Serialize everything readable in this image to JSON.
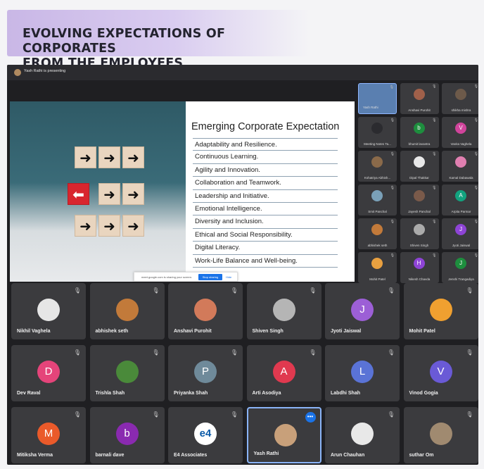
{
  "banner": {
    "title": "EVOLVING EXPECTATIONS OF CORPORATES\nFROM THE EMPLOYEES"
  },
  "meeting": {
    "presenting_text": "Yash Rathi is presenting",
    "slide": {
      "heading": "Emerging Corporate Expectation",
      "items": [
        "Adaptability and Resilience.",
        "Continuous Learning.",
        "Agility and Innovation.",
        "Collaboration and Teamwork.",
        "Leadership and Initiative.",
        "Emotional Intelligence.",
        "Diversity and Inclusion.",
        "Ethical and Social Responsibility.",
        "Digital Literacy.",
        "Work-Life Balance and Well-being."
      ]
    },
    "share_bar": {
      "text": "meet.google.com is sharing your screen.",
      "stop_label": "Stop sharing",
      "hide_label": "Hide"
    },
    "side_tiles": [
      {
        "name": "Yash Rathi",
        "initial": "",
        "color": "#5a7fb0",
        "self": true
      },
      {
        "name": "Anshavi Purohit",
        "initial": "",
        "color": "#a0604a"
      },
      {
        "name": "shikha mishra",
        "initial": "",
        "color": "#6d5a4a"
      },
      {
        "name": "Meeting Notes Ta...",
        "initial": "",
        "color": "#2b2b2f"
      },
      {
        "name": "bhumit lavantra",
        "initial": "b",
        "color": "#1e8e3e"
      },
      {
        "name": "Vanita Vaghela",
        "initial": "V",
        "color": "#d0449b"
      },
      {
        "name": "Kshatriya Abhish...",
        "initial": "",
        "color": "#8a6a4a"
      },
      {
        "name": "Dipal Thakkar",
        "initial": "",
        "color": "#e8e8e8"
      },
      {
        "name": "Kamal Dabawala",
        "initial": "",
        "color": "#e07fb0"
      },
      {
        "name": "Smit Panchal",
        "initial": "",
        "color": "#7aa0b8"
      },
      {
        "name": "Jayesh Panchal",
        "initial": "",
        "color": "#7a5a4a"
      },
      {
        "name": "Arpita Parmar",
        "initial": "A",
        "color": "#12a37f"
      },
      {
        "name": "abhishek seth",
        "initial": "",
        "color": "#c27a3a"
      },
      {
        "name": "Shiven Singh",
        "initial": "",
        "color": "#aaaaaa"
      },
      {
        "name": "Jyoti Jaiswal",
        "initial": "J",
        "color": "#8e44d6"
      },
      {
        "name": "Mohit Patel",
        "initial": "",
        "color": "#e8a040"
      },
      {
        "name": "Nikesh Chavda",
        "initial": "H",
        "color": "#8e44d6"
      },
      {
        "name": "Jenshi Trangadiya",
        "initial": "J",
        "color": "#1e8e3e"
      }
    ],
    "big_tiles": [
      {
        "name": "Nikhil Vaghela",
        "initial": "",
        "color": "#e6e6e6"
      },
      {
        "name": "abhishek seth",
        "initial": "",
        "color": "#c27a3a"
      },
      {
        "name": "Anshavi Purohit",
        "initial": "",
        "color": "#d27a5a"
      },
      {
        "name": "Shiven Singh",
        "initial": "",
        "color": "#b5b5b5"
      },
      {
        "name": "Jyoti Jaiswal",
        "initial": "J",
        "color": "#9c5fd6"
      },
      {
        "name": "Mohit Patel",
        "initial": "",
        "color": "#f0a030"
      },
      {
        "name": "Dev Raval",
        "initial": "D",
        "color": "#e5447a"
      },
      {
        "name": "Trishla Shah",
        "initial": "",
        "color": "#4a8a3a"
      },
      {
        "name": "Priyanka Shah",
        "initial": "P",
        "color": "#6f8a9a"
      },
      {
        "name": "Arti Asodiya",
        "initial": "A",
        "color": "#e0394f"
      },
      {
        "name": "Labdhi Shah",
        "initial": "L",
        "color": "#5a73d6"
      },
      {
        "name": "Vinod Gogia",
        "initial": "V",
        "color": "#6a5ad6"
      },
      {
        "name": "Mitiksha Verma",
        "initial": "M",
        "color": "#ea5a2a"
      },
      {
        "name": "barnali dave",
        "initial": "b",
        "color": "#8a2ab0"
      },
      {
        "name": "E4 Associates",
        "initial": "e4",
        "color": "#ffffff"
      },
      {
        "name": "Yash Rathi",
        "initial": "",
        "color": "#c8a07a",
        "active": true
      },
      {
        "name": "Arun Chauhan",
        "initial": "",
        "color": "#e8e8e8"
      },
      {
        "name": "suthar Om",
        "initial": "",
        "color": "#a08a70"
      }
    ],
    "colors": {
      "background": "#1f1f22",
      "tile": "#3b3b3e",
      "accent": "#1a73e8"
    }
  }
}
